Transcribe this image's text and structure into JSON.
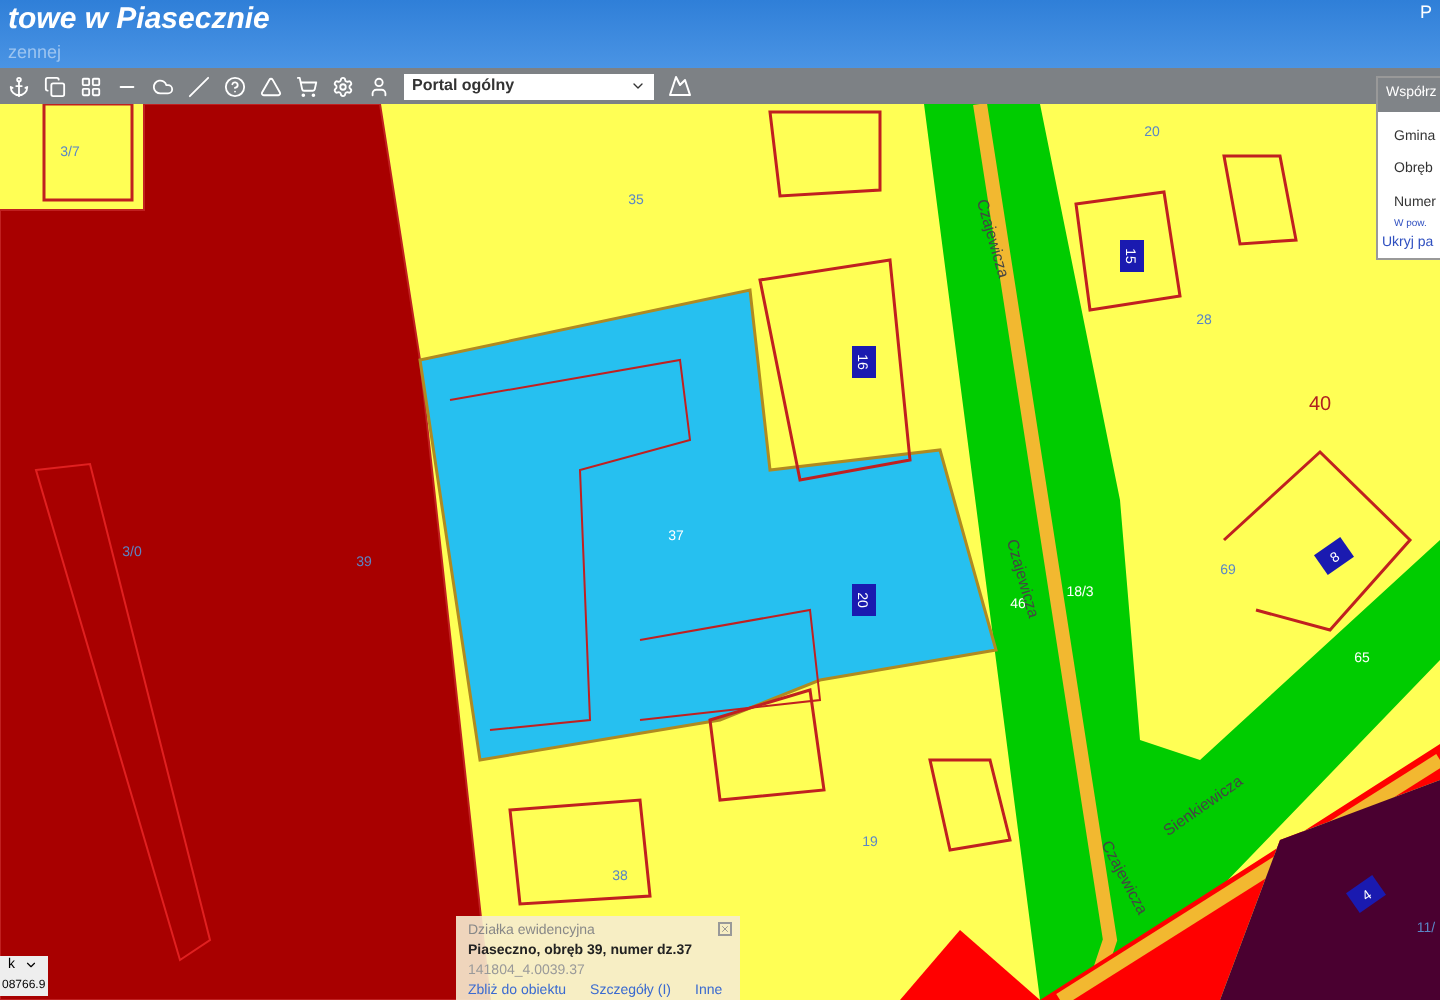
{
  "header": {
    "title": "towe w Piasecznie",
    "subtitle": "zennej",
    "corner": "P"
  },
  "toolbar": {
    "select_value": "Portal ogólny"
  },
  "map": {
    "labels": [
      {
        "text": "3/7",
        "kind": "parcel"
      },
      {
        "text": "35",
        "kind": "parcel"
      },
      {
        "text": "20",
        "kind": "parcel"
      },
      {
        "text": "28",
        "kind": "parcel"
      },
      {
        "text": "37",
        "kind": "parcel_light"
      },
      {
        "text": "3/0",
        "kind": "parcel"
      },
      {
        "text": "39",
        "kind": "parcel"
      },
      {
        "text": "46",
        "kind": "parcel_light"
      },
      {
        "text": "18/3",
        "kind": "parcel_light"
      },
      {
        "text": "69",
        "kind": "parcel"
      },
      {
        "text": "65",
        "kind": "parcel_light"
      },
      {
        "text": "40",
        "kind": "district"
      },
      {
        "text": "38",
        "kind": "parcel"
      },
      {
        "text": "19",
        "kind": "parcel"
      },
      {
        "text": "11/",
        "kind": "parcel"
      },
      {
        "text": "Czajewicza",
        "kind": "street"
      },
      {
        "text": "Czajewicza",
        "kind": "street"
      },
      {
        "text": "Czajewicza",
        "kind": "street"
      },
      {
        "text": "Sienkiewicza",
        "kind": "street"
      },
      {
        "text": "15",
        "kind": "building"
      },
      {
        "text": "16",
        "kind": "building"
      },
      {
        "text": "20",
        "kind": "building"
      },
      {
        "text": "8",
        "kind": "building"
      },
      {
        "text": "4",
        "kind": "building"
      }
    ]
  },
  "side_panel": {
    "title": "Współrz",
    "rows": [
      "Gmina",
      "Obręb",
      "Numer"
    ],
    "note": "W pow.",
    "link": "Ukryj pa"
  },
  "popup": {
    "title": "Działka ewidencyjna",
    "parcel": "Piaseczno, obręb 39, numer dz.37",
    "id": "141804_4.0039.37",
    "links": [
      "Zbliż do obiektu",
      "Szczegóły (I)",
      "Inne"
    ]
  },
  "scale_box": {
    "value": "k",
    "coordinate": "08766.9"
  }
}
